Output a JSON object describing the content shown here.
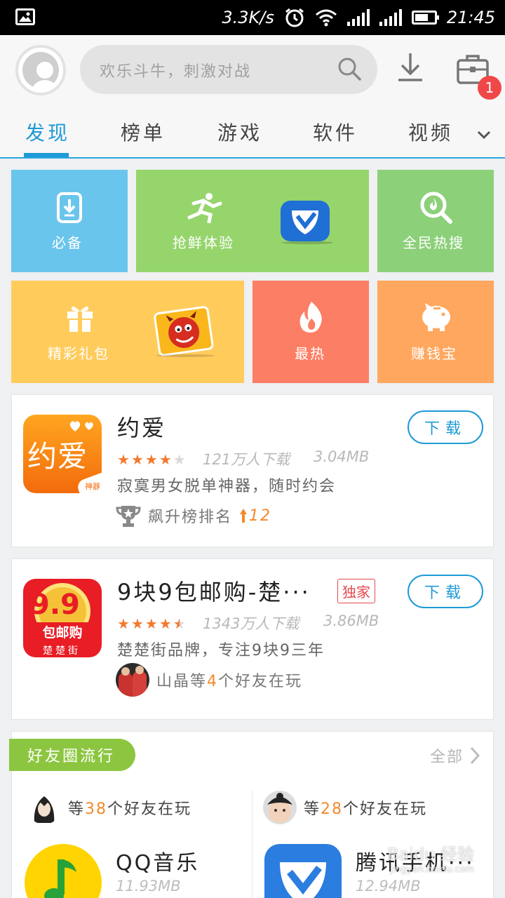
{
  "status_bar": {
    "speed": "3.3K/s",
    "time": "21:45",
    "icons": [
      "gallery-icon",
      "alarm-icon",
      "wifi-icon",
      "signal-icon",
      "signal-icon",
      "battery-icon"
    ]
  },
  "header": {
    "search_placeholder": "欢乐斗牛，刺激对战",
    "badge_count": "1"
  },
  "tabs": [
    {
      "label": "发现",
      "active": true
    },
    {
      "label": "榜单"
    },
    {
      "label": "游戏"
    },
    {
      "label": "软件"
    },
    {
      "label": "视频"
    }
  ],
  "tiles": [
    {
      "label": "必备",
      "color": "#6ac5ec",
      "icon": "phone-download-icon"
    },
    {
      "label": "抢鲜体验",
      "color": "#96d56c",
      "icon": "runner-icon"
    },
    {
      "label": "全民热搜",
      "color": "#8cd07a",
      "icon": "search-flame-icon"
    },
    {
      "label": "精彩礼包",
      "color": "#ffcc5c",
      "icon": "gift-icon"
    },
    {
      "label": "最热",
      "color": "#fc7e64",
      "icon": "flame-icon"
    },
    {
      "label": "赚钱宝",
      "color": "#ffa75f",
      "icon": "piggy-bank-icon"
    }
  ],
  "apps": [
    {
      "name": "约爱",
      "rating": 4,
      "downloads": "121万人下载",
      "size": "3.04MB",
      "desc": "寂寞男女脱单神器，随时约会",
      "extra_label": "飙升榜排名",
      "extra_value": "12",
      "download_label": "下载",
      "icon_text": "约爱",
      "icon_corner": "神器"
    },
    {
      "name": "9块9包邮购-楚···",
      "badge": "独家",
      "rating": 4.5,
      "downloads": "1343万人下载",
      "size": "3.86MB",
      "desc": "楚楚街品牌，专注9块9三年",
      "friend_name": "山晶等",
      "friend_count": "4",
      "friend_suffix": "个好友在玩",
      "download_label": "下载",
      "icon_big": "9.9",
      "icon_mid": "包邮购",
      "icon_small": "楚楚街"
    }
  ],
  "friends_circle": {
    "title": "好友圈流行",
    "see_all": "全部",
    "columns": [
      {
        "prefix": "等",
        "count": "38",
        "suffix": "个好友在玩",
        "app_name": "QQ音乐",
        "size": "11.93MB"
      },
      {
        "prefix": "等",
        "count": "28",
        "suffix": "个好友在玩",
        "app_name": "腾讯手机···",
        "size": "12.94MB"
      }
    ]
  },
  "watermark": {
    "text": "Baidu 经验",
    "sub": "jingyan.baidu.com"
  }
}
